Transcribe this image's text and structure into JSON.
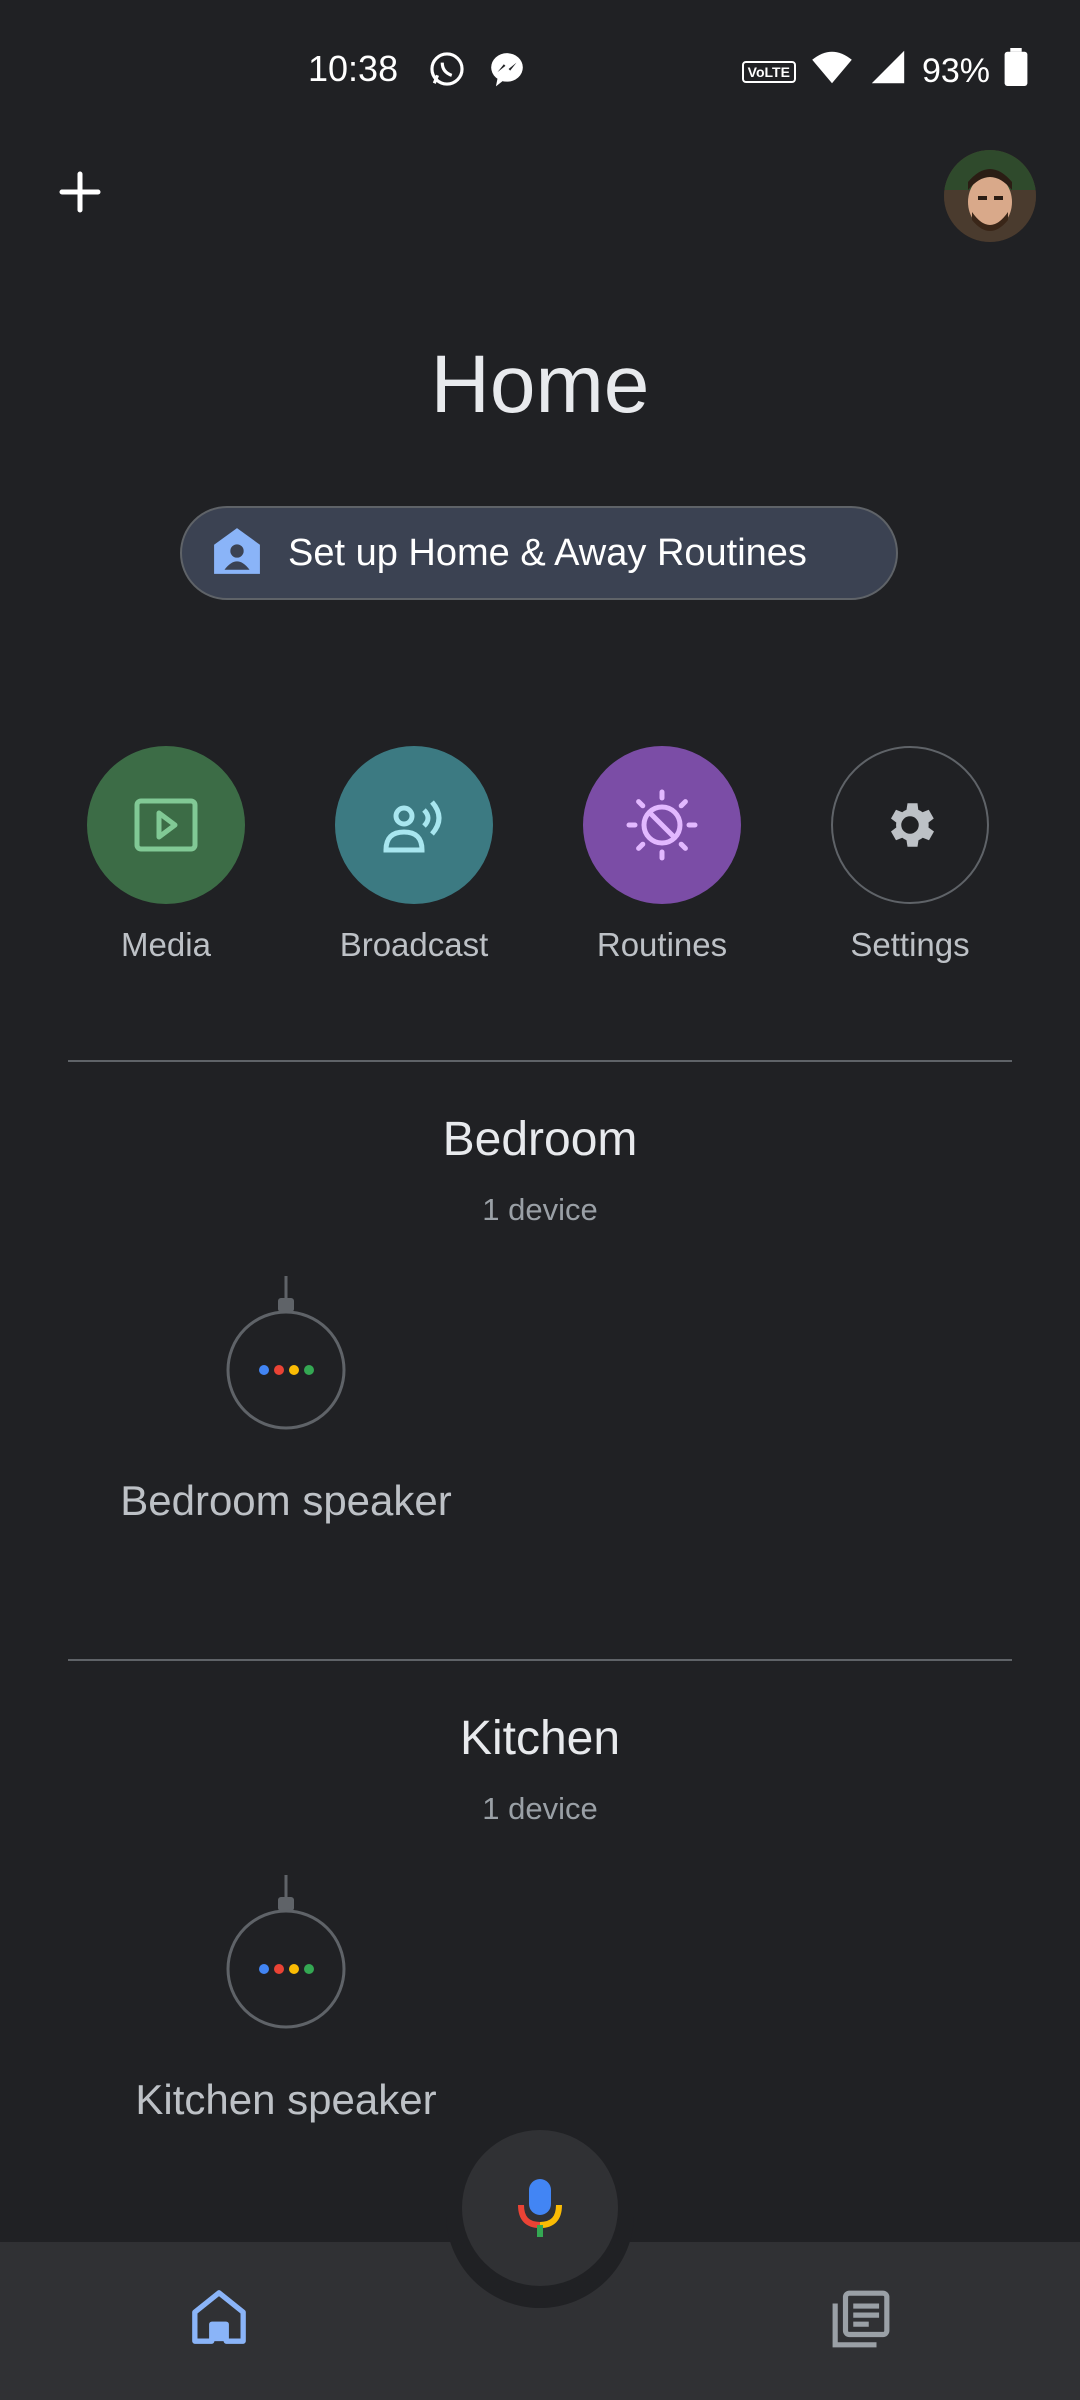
{
  "status_bar": {
    "time": "10:38",
    "volte": "VoLTE",
    "battery": "93%"
  },
  "header": {
    "title": "Home"
  },
  "routines_chip": {
    "label": "Set up Home & Away Routines"
  },
  "actions": [
    {
      "label": "Media",
      "icon": "play-icon",
      "color": "#3c6c46"
    },
    {
      "label": "Broadcast",
      "icon": "broadcast-icon",
      "color": "#3c7a82"
    },
    {
      "label": "Routines",
      "icon": "routines-icon",
      "color": "#7b4da6"
    },
    {
      "label": "Settings",
      "icon": "gear-icon",
      "color": "#202124"
    }
  ],
  "rooms": [
    {
      "name": "Bedroom",
      "count": "1 device",
      "devices": [
        {
          "label": "Bedroom speaker",
          "icon": "speaker-icon"
        }
      ]
    },
    {
      "name": "Kitchen",
      "count": "1 device",
      "devices": [
        {
          "label": "Kitchen speaker",
          "icon": "speaker-icon"
        }
      ]
    }
  ],
  "bottom_nav": {
    "items": [
      {
        "icon": "home-icon",
        "active": true
      },
      {
        "icon": "feed-icon",
        "active": false
      }
    ],
    "mic_icon": "mic-icon"
  },
  "colors": {
    "background": "#202124",
    "accent": "#8ab4f8",
    "google_blue": "#4285f4",
    "google_red": "#ea4335",
    "google_yellow": "#fbbc04",
    "google_green": "#34a853"
  }
}
